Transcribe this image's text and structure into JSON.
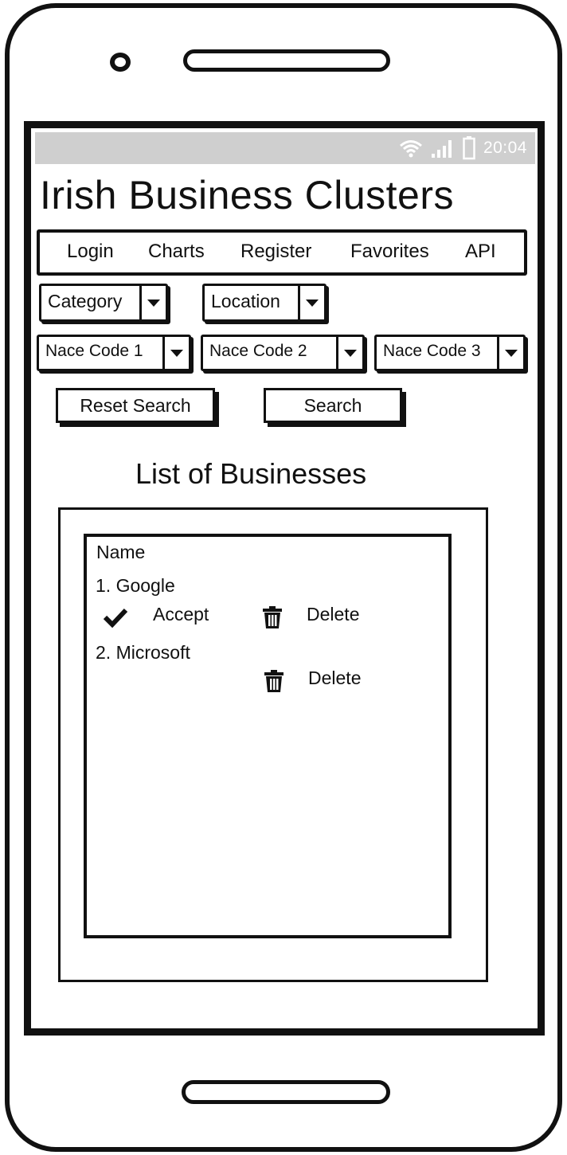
{
  "status": {
    "time": "20:04",
    "icons": [
      "wifi-icon",
      "signal-icon",
      "battery-icon"
    ]
  },
  "app": {
    "title": "Irish Business Clusters"
  },
  "nav": {
    "items": [
      "Login",
      "Charts",
      "Register",
      "Favorites",
      "API"
    ]
  },
  "filters": {
    "category": "Category",
    "location": "Location",
    "nace1": "Nace Code 1",
    "nace2": "Nace Code 2",
    "nace3": "Nace Code 3"
  },
  "buttons": {
    "reset": "Reset Search",
    "search": "Search"
  },
  "list": {
    "heading": "List of Businesses",
    "column_header": "Name",
    "items": [
      {
        "name": "1. Google",
        "accept_label": "Accept",
        "delete_label": "Delete"
      },
      {
        "name": "2. Microsoft",
        "delete_label": "Delete"
      }
    ]
  }
}
